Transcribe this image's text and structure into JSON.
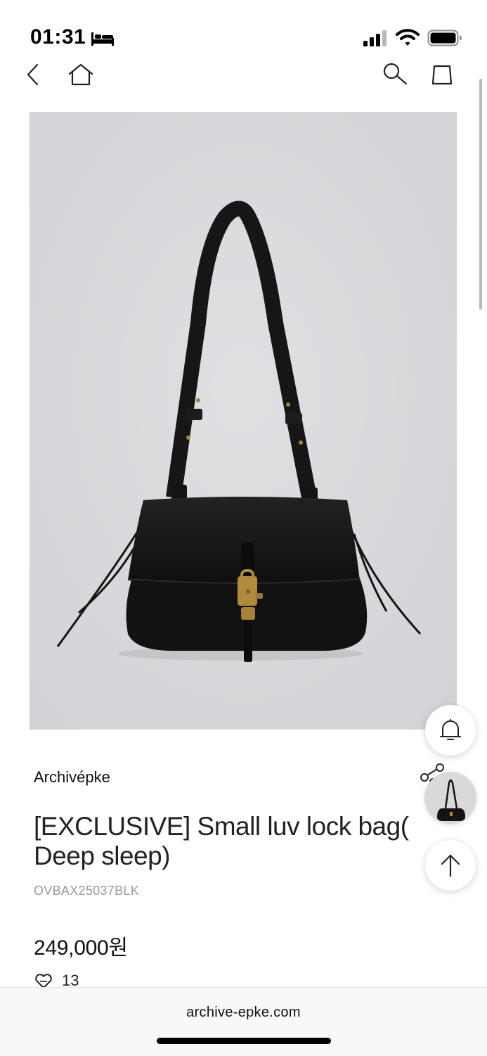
{
  "status_bar": {
    "time": "01:31",
    "focus_icon": "bed-icon",
    "signal_icon": "cellular-signal-icon",
    "wifi_icon": "wifi-icon",
    "battery_icon": "battery-icon"
  },
  "nav": {
    "back_icon": "chevron-left-icon",
    "home_icon": "home-icon",
    "search_icon": "search-icon",
    "bag_icon": "shopping-bag-icon"
  },
  "floating": {
    "alert_icon": "bell-icon",
    "share_icon": "share-icon",
    "top_icon": "arrow-up-icon"
  },
  "product": {
    "brand": "Archivépke",
    "title": "[EXCLUSIVE] Small luv lock bag( Deep sleep)",
    "sku": "OVBAX25037BLK",
    "price": "249,000원",
    "likes": "13"
  },
  "browser": {
    "url": "archive-epke.com"
  },
  "colors": {
    "image_background": "#dadadd",
    "bag": "#141414",
    "hardware": "#b08a3e",
    "sku_text": "#9a9a9a"
  }
}
